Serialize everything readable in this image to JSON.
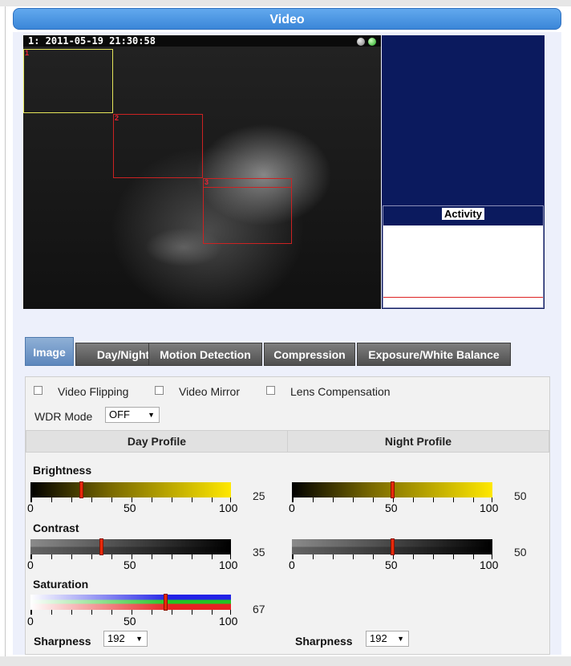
{
  "header": {
    "title": "Video"
  },
  "viewer": {
    "timestamp": "1:  2011-05-19 21:30:58"
  },
  "zones": [
    "1",
    "2",
    "3"
  ],
  "activity": {
    "title": "Activity"
  },
  "tabs": [
    "Image",
    "Day/Night",
    "Motion Detection",
    "Compression",
    "Exposure/White Balance"
  ],
  "options": {
    "video_flipping": "Video Flipping",
    "video_mirror": "Video Mirror",
    "lens_compensation": "Lens Compensation"
  },
  "wdr": {
    "label": "WDR Mode",
    "value": "OFF"
  },
  "profiles": {
    "day": {
      "title": "Day Profile",
      "brightness": {
        "label": "Brightness",
        "value": 25
      },
      "contrast": {
        "label": "Contrast",
        "value": 35
      },
      "saturation": {
        "label": "Saturation",
        "value": 67
      },
      "sharpness": {
        "label": "Sharpness",
        "value": "192"
      }
    },
    "night": {
      "title": "Night Profile",
      "brightness": {
        "value": 50
      },
      "contrast": {
        "value": 50
      },
      "sharpness": {
        "label": "Sharpness",
        "value": "192"
      }
    }
  },
  "scale": {
    "min": "0",
    "mid": "50",
    "max": "100"
  },
  "colors": {
    "header": "#3b86d8",
    "knob": "#e82a0b",
    "zone1": "#e6e65a",
    "zone_other": "#cc2222"
  }
}
